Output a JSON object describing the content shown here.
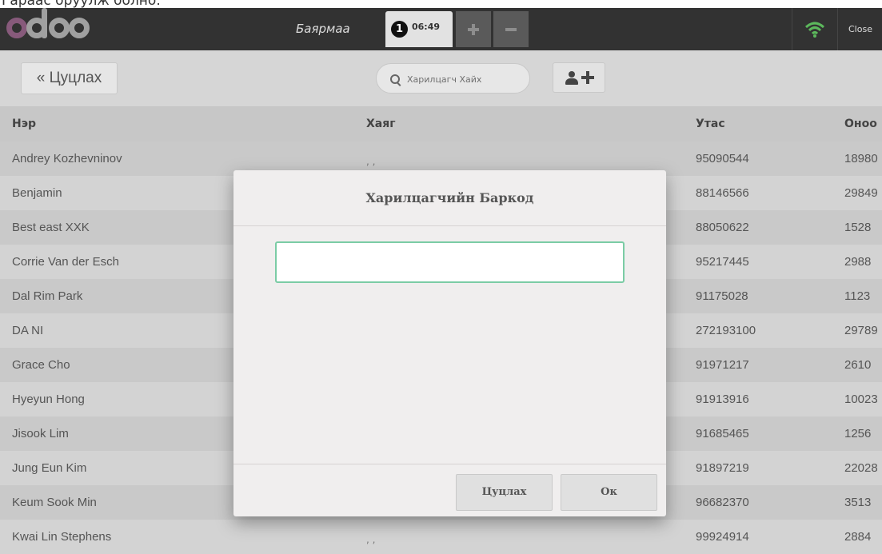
{
  "top_caption": "Гараас оруулж болно.",
  "navbar": {
    "cashier": "Баярмаа",
    "order_number": "1",
    "order_time": "06:49",
    "close_label": "Close",
    "colors": {
      "logo_primary": "#875a7b",
      "wifi": "#5cb85c"
    }
  },
  "toolbar": {
    "back_label": "« Цуцлах",
    "search_placeholder": "Харилцагч Хайх"
  },
  "table": {
    "headers": [
      "Нэр",
      "Хаяг",
      "Утас",
      "Оноо"
    ],
    "rows": [
      {
        "name": "Andrey Kozhevninov",
        "address": ", ,",
        "phone": "95090544",
        "points": "18980"
      },
      {
        "name": "Benjamin",
        "address": "",
        "phone": "88146566",
        "points": "29849"
      },
      {
        "name": "Best east XXK",
        "address": "",
        "phone": "88050622",
        "points": "1528"
      },
      {
        "name": "Corrie Van der Esch",
        "address": "",
        "phone": "95217445",
        "points": "2988"
      },
      {
        "name": "Dal Rim Park",
        "address": "",
        "phone": "91175028",
        "points": "1123"
      },
      {
        "name": "DA NI",
        "address": "",
        "phone": "272193100",
        "points": "29789"
      },
      {
        "name": "Grace Cho",
        "address": "",
        "phone": "91971217",
        "points": "2610"
      },
      {
        "name": "Hyeyun Hong",
        "address": "",
        "phone": "91913916",
        "points": "10023"
      },
      {
        "name": "Jisook Lim",
        "address": "",
        "phone": "91685465",
        "points": "1256"
      },
      {
        "name": "Jung Eun Kim",
        "address": "",
        "phone": "91897219",
        "points": "22028"
      },
      {
        "name": "Keum Sook Min",
        "address": "",
        "phone": "96682370",
        "points": "3513"
      },
      {
        "name": "Kwai Lin Stephens",
        "address": ", ,",
        "phone": "99924914",
        "points": "2884"
      }
    ]
  },
  "modal": {
    "title": "Харилцагчийн Баркод",
    "input_value": "",
    "cancel_label": "Цуцлах",
    "ok_label": "Ок"
  }
}
